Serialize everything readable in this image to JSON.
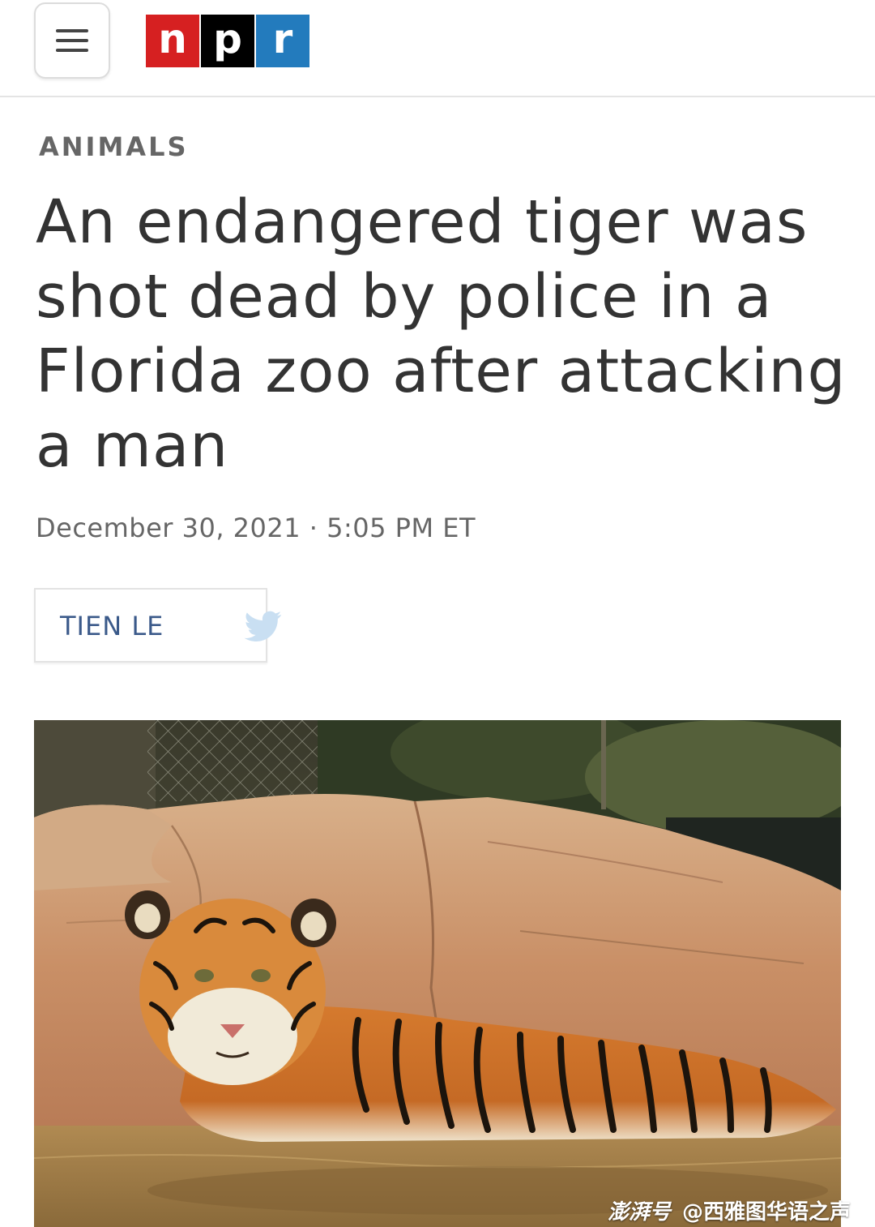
{
  "header": {
    "menu_icon": "hamburger-menu-icon",
    "logo": {
      "letters": [
        "n",
        "p",
        "r"
      ],
      "colors": [
        "#d62021",
        "#000000",
        "#237bbd"
      ]
    }
  },
  "article": {
    "category": "ANIMALS",
    "headline": "An endangered tiger was shot dead by police in a Florida zoo after attacking a man",
    "dateline": "December 30, 2021 · 5:05 PM ET",
    "author": "TIEN LE",
    "author_icon": "twitter-bird-icon"
  },
  "photo": {
    "subject": "tiger-photo"
  },
  "watermark": {
    "brand": "澎湃号",
    "account": "@西雅图华语之声"
  },
  "colors": {
    "twitter": "#c9dff2",
    "author_link": "#3b5a8a"
  }
}
